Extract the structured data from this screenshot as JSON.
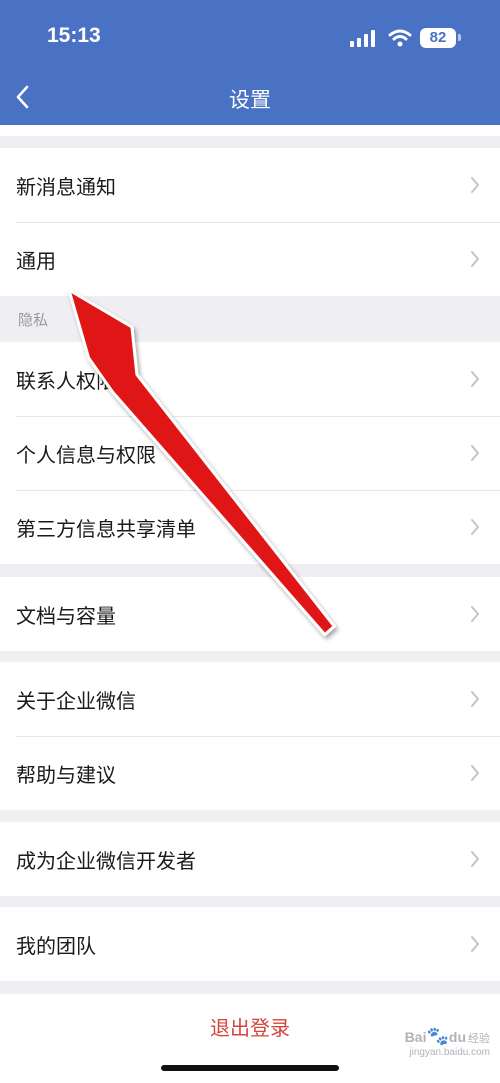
{
  "status_bar": {
    "time": "15:13",
    "battery": "82"
  },
  "nav": {
    "title": "设置"
  },
  "groups": {
    "notify": [
      "新消息通知",
      "通用"
    ],
    "privacy_header": "隐私",
    "privacy": [
      "联系人权限",
      "个人信息与权限",
      "第三方信息共享清单"
    ],
    "storage": [
      "文档与容量"
    ],
    "about": [
      "关于企业微信",
      "帮助与建议"
    ],
    "developer": [
      "成为企业微信开发者"
    ],
    "team": [
      "我的团队"
    ]
  },
  "logout": {
    "label": "退出登录"
  },
  "watermark": {
    "text": "Bai",
    "text2": "du",
    "sub": "经验",
    "url": "jingyan.baidu.com"
  },
  "colors": {
    "header": "#4a72c4",
    "logout": "#d6453b",
    "arrow": "#e01818",
    "background": "#efeff3"
  }
}
